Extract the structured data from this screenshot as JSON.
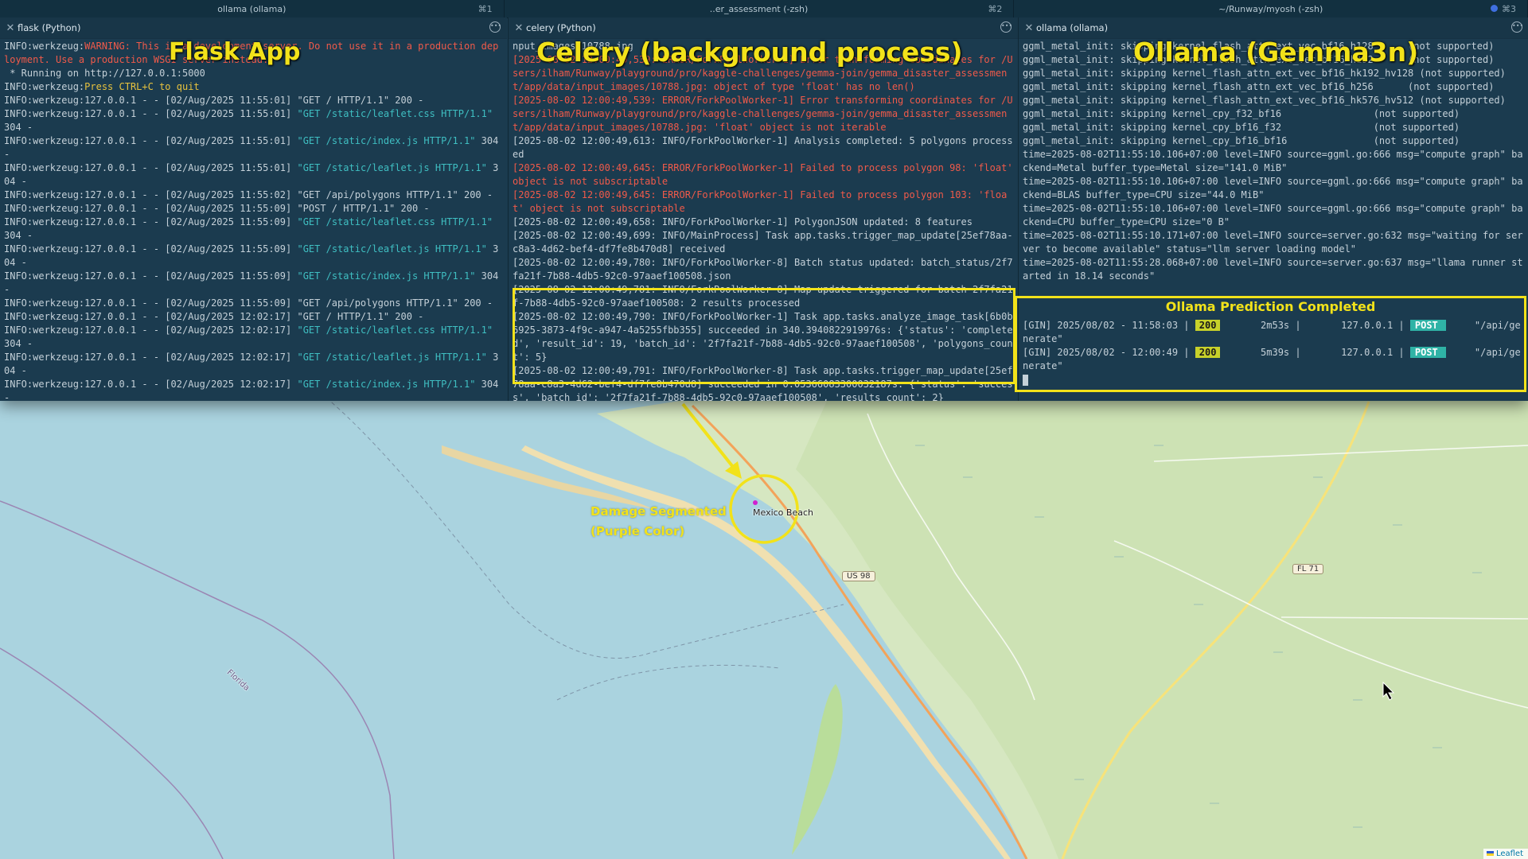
{
  "tabs": [
    {
      "title": "ollama (ollama)",
      "shortcut": "⌘1"
    },
    {
      "title": "..er_assessment (-zsh)",
      "shortcut": "⌘2"
    },
    {
      "title": "~/Runway/myosh (-zsh)",
      "shortcut": "⌘3"
    }
  ],
  "panes": {
    "flask": {
      "title": "flask (Python)"
    },
    "celery": {
      "title": "celery (Python)"
    },
    "ollama": {
      "title": "ollama (ollama)"
    }
  },
  "annotations": {
    "flask_label": "Flask App",
    "celery_label": "Celery (background process)",
    "ollama_label": "Ollama (Gemma3n)",
    "ollama_prediction": "Ollama Prediction Completed",
    "damage_line1": "Damage Segmented",
    "damage_line2": "(Purple Color)"
  },
  "flask_log": [
    [
      {
        "t": "INFO:werkzeug:"
      },
      {
        "t": "WARNING: This is a development server. Do not use it in a production deployment. Use a production WSGI server instead.",
        "c": "red"
      }
    ],
    [
      {
        "t": " * Running on http://127.0.0.1:5000"
      }
    ],
    [
      {
        "t": "INFO:werkzeug:"
      },
      {
        "t": "Press CTRL+C to quit",
        "c": "yel"
      }
    ],
    [
      {
        "t": "INFO:werkzeug:127.0.0.1 - - [02/Aug/2025 11:55:01] \"GET / HTTP/1.1\" 200 -"
      }
    ],
    [
      {
        "t": "INFO:werkzeug:127.0.0.1 - - [02/Aug/2025 11:55:01] "
      },
      {
        "t": "\"GET /static/leaflet.css HTTP/1.1\"",
        "c": "cy"
      },
      {
        "t": " 304 -"
      }
    ],
    [
      {
        "t": "INFO:werkzeug:127.0.0.1 - - [02/Aug/2025 11:55:01] "
      },
      {
        "t": "\"GET /static/index.js HTTP/1.1\"",
        "c": "cy"
      },
      {
        "t": " 304 -"
      }
    ],
    [
      {
        "t": "INFO:werkzeug:127.0.0.1 - - [02/Aug/2025 11:55:01] "
      },
      {
        "t": "\"GET /static/leaflet.js HTTP/1.1\"",
        "c": "cy"
      },
      {
        "t": " 304 -"
      }
    ],
    [
      {
        "t": "INFO:werkzeug:127.0.0.1 - - [02/Aug/2025 11:55:02] \"GET /api/polygons HTTP/1.1\" 200 -"
      }
    ],
    [
      {
        "t": "INFO:werkzeug:127.0.0.1 - - [02/Aug/2025 11:55:09] \"POST / HTTP/1.1\" 200 -"
      }
    ],
    [
      {
        "t": "INFO:werkzeug:127.0.0.1 - - [02/Aug/2025 11:55:09] "
      },
      {
        "t": "\"GET /static/leaflet.css HTTP/1.1\"",
        "c": "cy"
      },
      {
        "t": " 304 -"
      }
    ],
    [
      {
        "t": "INFO:werkzeug:127.0.0.1 - - [02/Aug/2025 11:55:09] "
      },
      {
        "t": "\"GET /static/leaflet.js HTTP/1.1\"",
        "c": "cy"
      },
      {
        "t": " 304 -"
      }
    ],
    [
      {
        "t": "INFO:werkzeug:127.0.0.1 - - [02/Aug/2025 11:55:09] "
      },
      {
        "t": "\"GET /static/index.js HTTP/1.1\"",
        "c": "cy"
      },
      {
        "t": " 304 -"
      }
    ],
    [
      {
        "t": "INFO:werkzeug:127.0.0.1 - - [02/Aug/2025 11:55:09] \"GET /api/polygons HTTP/1.1\" 200 -"
      }
    ],
    [
      {
        "t": "INFO:werkzeug:127.0.0.1 - - [02/Aug/2025 12:02:17] \"GET / HTTP/1.1\" 200 -"
      }
    ],
    [
      {
        "t": "INFO:werkzeug:127.0.0.1 - - [02/Aug/2025 12:02:17] "
      },
      {
        "t": "\"GET /static/leaflet.css HTTP/1.1\"",
        "c": "cy"
      },
      {
        "t": " 304 -"
      }
    ],
    [
      {
        "t": "INFO:werkzeug:127.0.0.1 - - [02/Aug/2025 12:02:17] "
      },
      {
        "t": "\"GET /static/leaflet.js HTTP/1.1\"",
        "c": "cy"
      },
      {
        "t": " 304 -"
      }
    ],
    [
      {
        "t": "INFO:werkzeug:127.0.0.1 - - [02/Aug/2025 12:02:17] "
      },
      {
        "t": "\"GET /static/index.js HTTP/1.1\"",
        "c": "cy"
      },
      {
        "t": " 304 -"
      }
    ],
    [
      {
        "t": "INFO:werkzeug:127.0.0.1 - - [02/Aug/2025 12:02:17] \"GET /api/polygons HTTP/1.1\" 200 -"
      }
    ]
  ],
  "celery_log": [
    [
      {
        "t": "nput_images/10788.jpg"
      }
    ],
    [
      {
        "t": "[2025-08-02 12:00:49,5",
        "c": "red"
      },
      {
        "t": "39: ERROR/ForkPoolWorker-1] Error transforming coordinates for /Users/ilham/Runway/playground/pro/kaggle-challenges/gemma-join/gemma_disaster_assessment/app/data/input_images/10788.jpg: object of type 'float' has no len()",
        "c": "red"
      }
    ],
    [
      {
        "t": "[2025-08-02 12:00:49,539: ERROR/ForkPoolWorker-1] Error transforming coordinates for /Users/ilham/Runway/playground/pro/kaggle-challenges/gemma-join/gemma_disaster_assessment/app/data/input_images/10788.jpg: 'float' object is not iterable",
        "c": "red"
      }
    ],
    [
      {
        "t": "[2025-08-02 12:00:49,613: INFO/ForkPoolWorker-1] Analysis completed: 5 polygons processed"
      }
    ],
    [
      {
        "t": "[2025-08-02 12:00:49,645: ERROR/ForkPoolWorker-1] Failed to process polygon 98: 'float' object is not subscriptable",
        "c": "red"
      }
    ],
    [
      {
        "t": "[2025-08-02 12:00:49,645: ERROR/ForkPoolWorker-1] Failed to process polygon 103: 'float' object is not subscriptable",
        "c": "red"
      }
    ],
    [
      {
        "t": "[2025-08-02 12:00:49,658: INFO/ForkPoolWorker-1] PolygonJSON updated: 8 features"
      }
    ],
    [
      {
        "t": "[2025-08-02 12:00:49,699: INFO/MainProcess] Task app.tasks.trigger_map_update[25ef78aa-c8a3-4d62-bef4-df7fe8b470d8] received"
      }
    ],
    [
      {
        "t": "[2025-08-02 12:00:49,780: INFO/ForkPoolWorker-8] Batch status updated: batch_status/2f7fa21f-7b88-4db5-92c0-97aaef100508.json"
      }
    ],
    [
      {
        "t": "[2025-08-02 12:00:49,781: INFO/ForkPoolWorker-8] Map update triggered for batch 2f7fa21f-7b88-4db5-92c0-97aaef100508: 2 results processed"
      }
    ],
    [
      {
        "t": "[2025-08-02 12:00:49,790: INFO/ForkPoolWorker-1] Task app.tasks.analyze_image_task[6b0b6925-3873-4f9c-a947-4a5255fbb355] succeeded in 340.3940822919976s: {'status': 'completed', 'result_id': 19, 'batch_id': '2f7fa21f-7b88-4db5-92c0-97aaef100508', 'polygons_count': 5}"
      }
    ],
    [
      {
        "t": "[2025-08-02 12:00:49,791: INFO/ForkPoolWorker-8] Task app.tasks.trigger_map_update[25ef78aa-c8a3-4d62-bef4-df7fe8b470d8] succeeded in 0.05366083300032187s: {'status': 'success', 'batch_id': '2f7fa21f-7b88-4db5-92c0-97aaef100508', 'results_count': 2}"
      }
    ]
  ],
  "ollama_log": [
    [
      {
        "t": "ggml_metal_init: skipping kernel_flash_attn_ext_vec_bf16_h128      (not supported)"
      }
    ],
    [
      {
        "t": "ggml_metal_init: skipping kernel_flash_attn_ext_vec_bf16_h192      (not supported)"
      }
    ],
    [
      {
        "t": "ggml_metal_init: skipping kernel_flash_attn_ext_vec_bf16_hk192_hv128 (not supported)"
      }
    ],
    [
      {
        "t": "ggml_metal_init: skipping kernel_flash_attn_ext_vec_bf16_h256      (not supported)"
      }
    ],
    [
      {
        "t": "ggml_metal_init: skipping kernel_flash_attn_ext_vec_bf16_hk576_hv512 (not supported)"
      }
    ],
    [
      {
        "t": "ggml_metal_init: skipping kernel_cpy_f32_bf16                (not supported)"
      }
    ],
    [
      {
        "t": "ggml_metal_init: skipping kernel_cpy_bf16_f32                (not supported)"
      }
    ],
    [
      {
        "t": "ggml_metal_init: skipping kernel_cpy_bf16_bf16               (not supported)"
      }
    ],
    [
      {
        "t": "time=2025-08-02T11:55:10.106+07:00 level=INFO source=ggml.go:666 msg=\"compute graph\" backend=Metal buffer_type=Metal size=\"141.0 MiB\""
      }
    ],
    [
      {
        "t": "time=2025-08-02T11:55:10.106+07:00 level=INFO source=ggml.go:666 msg=\"compute graph\" backend=BLAS buffer_type=CPU size=\"44.0 MiB\""
      }
    ],
    [
      {
        "t": "time=2025-08-02T11:55:10.106+07:00 level=INFO source=ggml.go:666 msg=\"compute graph\" backend=CPU buffer_type=CPU size=\"0 B\""
      }
    ],
    [
      {
        "t": "time=2025-08-02T11:55:10.171+07:00 level=INFO source=server.go:632 msg=\"waiting for server to become available\" status=\"llm server loading model\""
      }
    ],
    [
      {
        "t": "time=2025-08-02T11:55:28.068+07:00 level=INFO source=server.go:637 msg=\"llama runner started in 18.14 seconds\""
      }
    ]
  ],
  "gin_log": [
    {
      "prefix": "[GIN] 2025/08/02 - 11:58:03 |",
      "status": "200",
      "latency": "      2m53s |",
      "ip": "       127.0.0.1 |",
      "method": "POST",
      "path": "     \"/api/generate\""
    },
    {
      "prefix": "[GIN] 2025/08/02 - 12:00:49 |",
      "status": "200",
      "latency": "      5m39s |",
      "ip": "       127.0.0.1 |",
      "method": "POST",
      "path": "     \"/api/generate\""
    }
  ],
  "map": {
    "places": {
      "mexico_beach": "Mexico Beach",
      "florida": "Florida"
    },
    "roads": {
      "us98": "US 98",
      "fl71": "FL 71"
    },
    "attribution": "Leaflet"
  }
}
